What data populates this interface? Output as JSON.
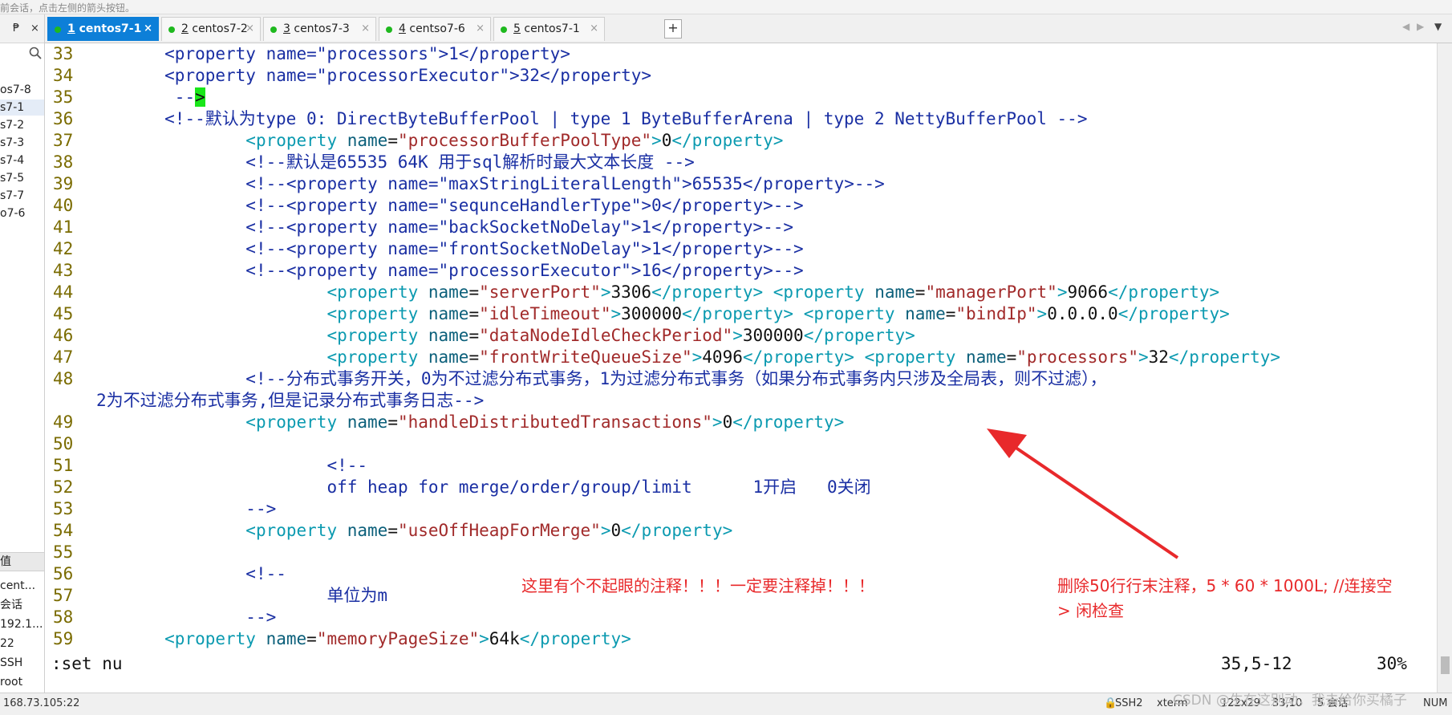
{
  "topbar": {
    "hint": "前会话，点击左侧的箭头按钮。"
  },
  "left_panel": {
    "pin_label": "₱",
    "close_label": "×",
    "sessions": [
      "os7-8",
      "s7-1",
      "s7-2",
      "s7-3",
      "s7-4",
      "s7-5",
      "s7-7",
      "o7-6"
    ],
    "selected_index": 1,
    "prop_header": "值",
    "prop_values": [
      "cent...",
      "会话",
      "192.1...",
      "22",
      "SSH",
      "root"
    ]
  },
  "tabs": [
    {
      "num": "1",
      "name": "centos7-1",
      "active": true
    },
    {
      "num": "2",
      "name": "centos7-2",
      "active": false
    },
    {
      "num": "3",
      "name": "centos7-3",
      "active": false
    },
    {
      "num": "4",
      "name": "centso7-6",
      "active": false
    },
    {
      "num": "5",
      "name": "centos7-1",
      "active": false
    }
  ],
  "add_tab_label": "+",
  "terminal": {
    "lines": [
      {
        "n": "33",
        "segs": [
          [
            "t",
            "        "
          ],
          [
            "b",
            "<property name=\"processors\">1</property>"
          ]
        ]
      },
      {
        "n": "34",
        "segs": [
          [
            "t",
            "        "
          ],
          [
            "b",
            "<property name=\"processorExecutor\">32</property>"
          ]
        ]
      },
      {
        "n": "35",
        "segs": [
          [
            "t",
            "         "
          ],
          [
            "b",
            "--"
          ],
          [
            "c",
            ">"
          ]
        ]
      },
      {
        "n": "36",
        "segs": [
          [
            "t",
            "        "
          ],
          [
            "b",
            "<!--默认为type 0: DirectByteBufferPool | type 1 ByteBufferArena | type 2 NettyBufferPool -->"
          ]
        ]
      },
      {
        "n": "37",
        "segs": [
          [
            "t",
            "                "
          ],
          [
            "g",
            "<property "
          ],
          [
            "a",
            "name"
          ],
          [
            "t",
            "="
          ],
          [
            "s",
            "\"processorBufferPoolType\""
          ],
          [
            "g",
            ">"
          ],
          [
            "t",
            "0"
          ],
          [
            "g",
            "</property>"
          ]
        ]
      },
      {
        "n": "38",
        "segs": [
          [
            "t",
            "                "
          ],
          [
            "b",
            "<!--默认是65535 64K 用于sql解析时最大文本长度 -->"
          ]
        ]
      },
      {
        "n": "39",
        "segs": [
          [
            "t",
            "                "
          ],
          [
            "b",
            "<!--<property name=\"maxStringLiteralLength\">65535</property>-->"
          ]
        ]
      },
      {
        "n": "40",
        "segs": [
          [
            "t",
            "                "
          ],
          [
            "b",
            "<!--<property name=\"sequnceHandlerType\">0</property>-->"
          ]
        ]
      },
      {
        "n": "41",
        "segs": [
          [
            "t",
            "                "
          ],
          [
            "b",
            "<!--<property name=\"backSocketNoDelay\">1</property>-->"
          ]
        ]
      },
      {
        "n": "42",
        "segs": [
          [
            "t",
            "                "
          ],
          [
            "b",
            "<!--<property name=\"frontSocketNoDelay\">1</property>-->"
          ]
        ]
      },
      {
        "n": "43",
        "segs": [
          [
            "t",
            "                "
          ],
          [
            "b",
            "<!--<property name=\"processorExecutor\">16</property>-->"
          ]
        ]
      },
      {
        "n": "44",
        "segs": [
          [
            "t",
            "                        "
          ],
          [
            "g",
            "<property "
          ],
          [
            "a",
            "name"
          ],
          [
            "t",
            "="
          ],
          [
            "s",
            "\"serverPort\""
          ],
          [
            "g",
            ">"
          ],
          [
            "t",
            "3306"
          ],
          [
            "g",
            "</property> <property "
          ],
          [
            "a",
            "name"
          ],
          [
            "t",
            "="
          ],
          [
            "s",
            "\"managerPort\""
          ],
          [
            "g",
            ">"
          ],
          [
            "t",
            "9066"
          ],
          [
            "g",
            "</property>"
          ]
        ]
      },
      {
        "n": "45",
        "segs": [
          [
            "t",
            "                        "
          ],
          [
            "g",
            "<property "
          ],
          [
            "a",
            "name"
          ],
          [
            "t",
            "="
          ],
          [
            "s",
            "\"idleTimeout\""
          ],
          [
            "g",
            ">"
          ],
          [
            "t",
            "300000"
          ],
          [
            "g",
            "</property> <property "
          ],
          [
            "a",
            "name"
          ],
          [
            "t",
            "="
          ],
          [
            "s",
            "\"bindIp\""
          ],
          [
            "g",
            ">"
          ],
          [
            "t",
            "0.0.0.0"
          ],
          [
            "g",
            "</property>"
          ]
        ]
      },
      {
        "n": "46",
        "segs": [
          [
            "t",
            "                        "
          ],
          [
            "g",
            "<property "
          ],
          [
            "a",
            "name"
          ],
          [
            "t",
            "="
          ],
          [
            "s",
            "\"dataNodeIdleCheckPeriod\""
          ],
          [
            "g",
            ">"
          ],
          [
            "t",
            "300000"
          ],
          [
            "g",
            "</property>"
          ]
        ]
      },
      {
        "n": "47",
        "segs": [
          [
            "t",
            "                        "
          ],
          [
            "g",
            "<property "
          ],
          [
            "a",
            "name"
          ],
          [
            "t",
            "="
          ],
          [
            "s",
            "\"frontWriteQueueSize\""
          ],
          [
            "g",
            ">"
          ],
          [
            "t",
            "4096"
          ],
          [
            "g",
            "</property> <property "
          ],
          [
            "a",
            "name"
          ],
          [
            "t",
            "="
          ],
          [
            "s",
            "\"processors\""
          ],
          [
            "g",
            ">"
          ],
          [
            "t",
            "32"
          ],
          [
            "g",
            "</property>"
          ]
        ]
      },
      {
        "n": "48",
        "segs": [
          [
            "t",
            "                "
          ],
          [
            "b",
            "<!--分布式事务开关，0为不过滤分布式事务，1为过滤分布式事务（如果分布式事务内只涉及全局表，则不过滤），"
          ]
        ]
      },
      {
        "n": "",
        "segs": [
          [
            "b",
            "2为不过滤分布式事务,但是记录分布式事务日志-->"
          ]
        ]
      },
      {
        "n": "49",
        "segs": [
          [
            "t",
            "                "
          ],
          [
            "g",
            "<property "
          ],
          [
            "a",
            "name"
          ],
          [
            "t",
            "="
          ],
          [
            "s",
            "\"handleDistributedTransactions\""
          ],
          [
            "g",
            ">"
          ],
          [
            "t",
            "0"
          ],
          [
            "g",
            "</property>"
          ]
        ]
      },
      {
        "n": "50",
        "segs": []
      },
      {
        "n": "51",
        "segs": [
          [
            "t",
            "                        "
          ],
          [
            "b",
            "<!--"
          ]
        ]
      },
      {
        "n": "52",
        "segs": [
          [
            "t",
            "                        "
          ],
          [
            "b",
            "off heap for merge/order/group/limit      1开启   0关闭"
          ]
        ]
      },
      {
        "n": "53",
        "segs": [
          [
            "t",
            "                "
          ],
          [
            "b",
            "-->"
          ]
        ]
      },
      {
        "n": "54",
        "segs": [
          [
            "t",
            "                "
          ],
          [
            "g",
            "<property "
          ],
          [
            "a",
            "name"
          ],
          [
            "t",
            "="
          ],
          [
            "s",
            "\"useOffHeapForMerge\""
          ],
          [
            "g",
            ">"
          ],
          [
            "t",
            "0"
          ],
          [
            "g",
            "</property>"
          ]
        ]
      },
      {
        "n": "55",
        "segs": []
      },
      {
        "n": "56",
        "segs": [
          [
            "t",
            "                "
          ],
          [
            "b",
            "<!--"
          ]
        ]
      },
      {
        "n": "57",
        "segs": [
          [
            "t",
            "                        "
          ],
          [
            "b",
            "单位为m"
          ]
        ]
      },
      {
        "n": "58",
        "segs": [
          [
            "t",
            "                "
          ],
          [
            "b",
            "-->"
          ]
        ]
      },
      {
        "n": "59",
        "segs": [
          [
            "t",
            "        "
          ],
          [
            "g",
            "<property "
          ],
          [
            "a",
            "name"
          ],
          [
            "t",
            "="
          ],
          [
            "s",
            "\"memoryPageSize\""
          ],
          [
            "g",
            ">"
          ],
          [
            "t",
            "64k"
          ],
          [
            "g",
            "</property>"
          ]
        ]
      }
    ],
    "command": ":set nu",
    "cursor_pos": "35,5-12",
    "scroll_pct": "30%"
  },
  "annotations": {
    "left_note": "这里有个不起眼的注释！！！一定要注释掉！！！",
    "right_note_line1": "删除50行行末注释，5 * 60 * 1000L; //连接空",
    "right_note_line2": ">    闲检查",
    "arrow_color": "#e8292b"
  },
  "statusbar": {
    "address": "168.73.105:22",
    "protocol": "SSH2",
    "terminal": "xterm",
    "size": "122x29",
    "position": "33,10",
    "sessions": "5 会话",
    "num": "NUM",
    "watermark": "CSDN @生在这别动，我去给你买橘子"
  },
  "colors": {
    "active_tab": "#0d7fd8",
    "session_dot": "#1fb91f",
    "cursor": "#19e619",
    "annotation": "#e8292b"
  }
}
